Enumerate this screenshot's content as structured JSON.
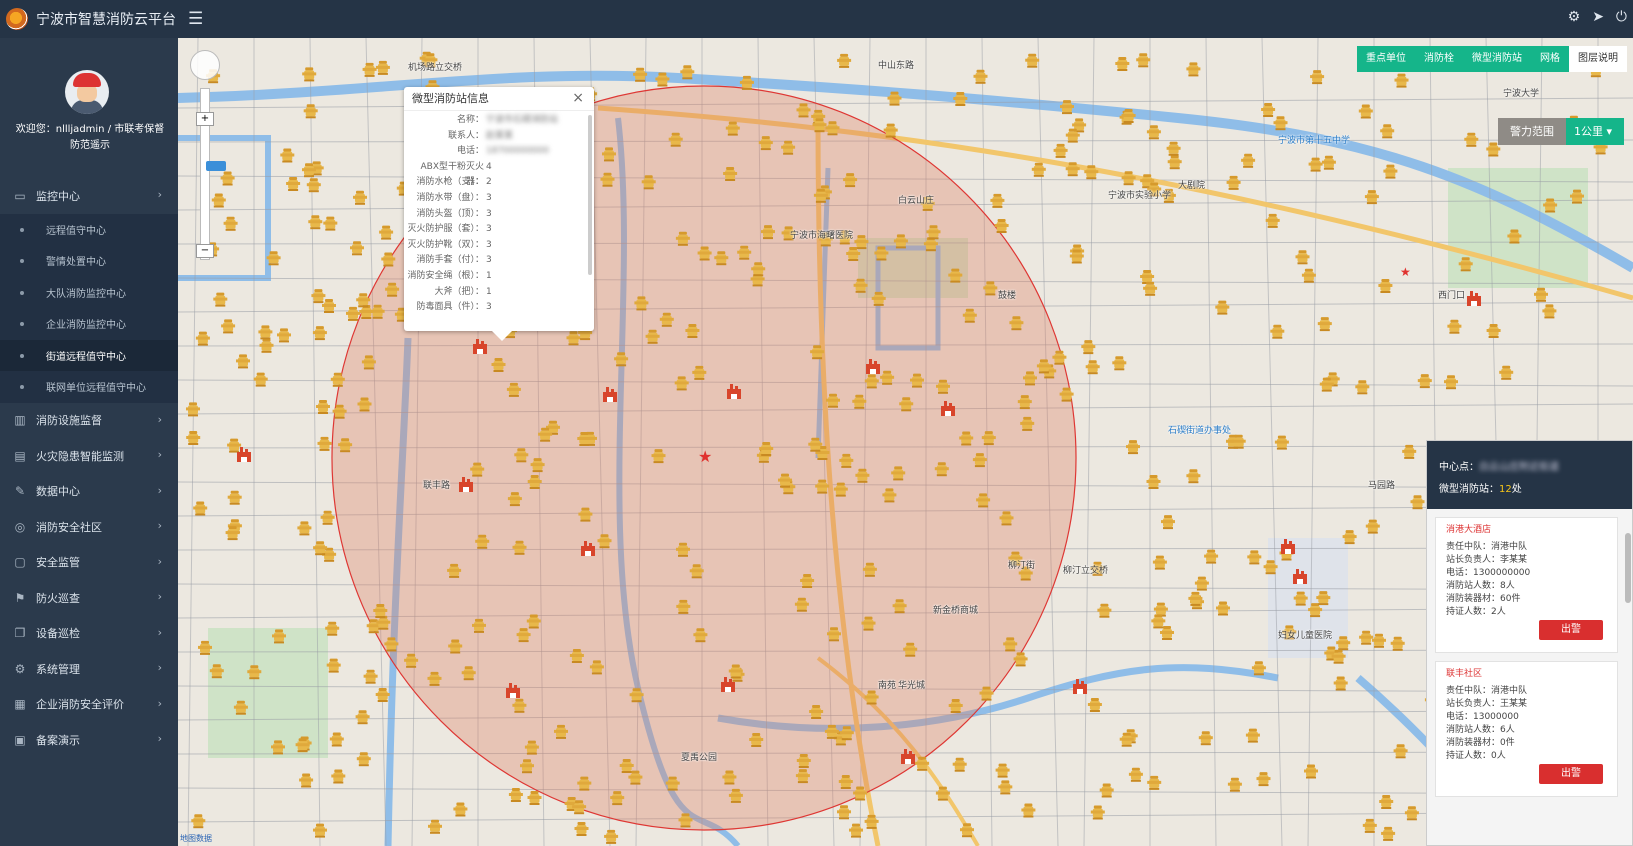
{
  "header": {
    "title": "宁波市智慧消防云平台",
    "menu_icon": "hamburger-icon",
    "right_icons": [
      "gear-icon",
      "send-icon",
      "power-icon"
    ]
  },
  "user": {
    "welcome": "欢迎您：nllljadmin / 市联考保督",
    "org": "防范遥示"
  },
  "sidebar": {
    "monitor": {
      "label": "监控中心",
      "icon": "monitor-icon"
    },
    "submenu": [
      {
        "label": "远程值守中心"
      },
      {
        "label": "警情处置中心"
      },
      {
        "label": "大队消防监控中心"
      },
      {
        "label": "企业消防监控中心"
      },
      {
        "label": "街道远程值守中心",
        "active": true
      },
      {
        "label": "联网单位远程值守中心"
      }
    ],
    "menus": [
      {
        "label": "消防设施监督",
        "icon": "building-icon"
      },
      {
        "label": "火灾隐患智能监测",
        "icon": "chart-icon"
      },
      {
        "label": "数据中心",
        "icon": "edit-icon"
      },
      {
        "label": "消防安全社区",
        "icon": "community-icon"
      },
      {
        "label": "安全监管",
        "icon": "doc-icon"
      },
      {
        "label": "防火巡查",
        "icon": "patrol-icon"
      },
      {
        "label": "设备巡检",
        "icon": "copy-icon"
      },
      {
        "label": "系统管理",
        "icon": "settings-icon"
      },
      {
        "label": "企业消防安全评价",
        "icon": "grid-icon"
      },
      {
        "label": "备案演示",
        "icon": "calendar-icon"
      }
    ]
  },
  "map": {
    "layer_tabs": [
      "重点单位",
      "消防栓",
      "微型消防站",
      "网格",
      "图层说明"
    ],
    "force_label": "警力范围",
    "force_value": "1公里",
    "zoom_in": "+",
    "zoom_out": "−",
    "copyright": "地图数据",
    "labels": [
      {
        "text": "机场路立交桥"
      },
      {
        "text": "中山东路"
      },
      {
        "text": "宁波市海曙医院"
      },
      {
        "text": "白云山庄"
      },
      {
        "text": "鼓楼"
      },
      {
        "text": "宁波市第十五中学"
      },
      {
        "text": "宁波市实验小学"
      },
      {
        "text": "大剧院"
      },
      {
        "text": "西门口"
      },
      {
        "text": "柳汀街"
      },
      {
        "text": "石碶街道办事处"
      },
      {
        "text": "南苑"
      },
      {
        "text": "夏禹公园"
      },
      {
        "text": "宁波大学"
      },
      {
        "text": "妇女儿童医院"
      },
      {
        "text": "柳汀立交桥"
      },
      {
        "text": "新金桥商城"
      },
      {
        "text": "华光城"
      },
      {
        "text": "马园路"
      },
      {
        "text": "联丰路"
      }
    ]
  },
  "popup": {
    "title": "微型消防站信息",
    "close": "×",
    "rows": [
      {
        "k": "名称：",
        "v": "宁波市石碶消防站",
        "blur": true
      },
      {
        "k": "联系人：",
        "v": "赵某某",
        "blur": true
      },
      {
        "k": "电话：",
        "v": "18700000000",
        "blur": true
      },
      {
        "k": "ABX型干粉灭火器：",
        "v": "4"
      },
      {
        "k": "消防水枪（支）：",
        "v": "2"
      },
      {
        "k": "消防水带（盘）：",
        "v": "3"
      },
      {
        "k": "消防头盔（顶）：",
        "v": "3"
      },
      {
        "k": "灭火防护服（套）：",
        "v": "3"
      },
      {
        "k": "灭火防护靴（双）：",
        "v": "3"
      },
      {
        "k": "消防手套（付）：",
        "v": "3"
      },
      {
        "k": "消防安全绳（根）：",
        "v": "1"
      },
      {
        "k": "大斧（把）：",
        "v": "1"
      },
      {
        "k": "防毒面具（件）：",
        "v": "3"
      }
    ]
  },
  "panel": {
    "center_label": "中心点：",
    "center_value": "白云山庄附近街道",
    "station_label": "微型消防站：",
    "station_count": "12",
    "station_unit": "处",
    "cards": [
      {
        "name": "消港大酒店",
        "rows": [
          "责任中队：消港中队",
          "站长负责人：李某某",
          "电话：1300000000",
          "消防站人数：8人",
          "消防装器材：60件",
          "持证人数：2人"
        ],
        "button": "出警"
      },
      {
        "name": "联丰社区",
        "rows": [
          "责任中队：消港中队",
          "站长负责人：王某某",
          "电话：13000000",
          "消防站人数：6人",
          "消防装器材：0件",
          "持证人数：0人"
        ],
        "button": "出警"
      }
    ]
  },
  "colors": {
    "header_bg": "#253446",
    "sidebar_bg": "#2b3a4c",
    "accent_green": "#15b58a",
    "alert_red": "#d92f2f",
    "circle": "#e0322f",
    "hydrant": "#e8b84a"
  }
}
